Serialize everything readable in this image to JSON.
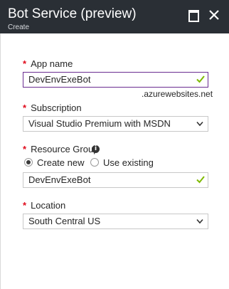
{
  "blade": {
    "title": "Bot Service (preview)",
    "subtitle": "Create"
  },
  "form": {
    "app_name": {
      "label": "App name",
      "value": "DevEnvExeBot",
      "suffix": ".azurewebsites.net"
    },
    "subscription": {
      "label": "Subscription",
      "value": "Visual Studio Premium with MSDN"
    },
    "resource_group": {
      "label": "Resource Group",
      "info_glyph": "i",
      "options": {
        "create_new": "Create new",
        "use_existing": "Use existing"
      },
      "selected": "Create new",
      "value": "DevEnvExeBot"
    },
    "location": {
      "label": "Location",
      "value": "South Central US"
    },
    "required_marker": "*"
  },
  "colors": {
    "header_bg": "#2a2f35",
    "focus_border": "#6a2c91",
    "valid_check": "#7fba00",
    "required": "#e00b1c"
  }
}
